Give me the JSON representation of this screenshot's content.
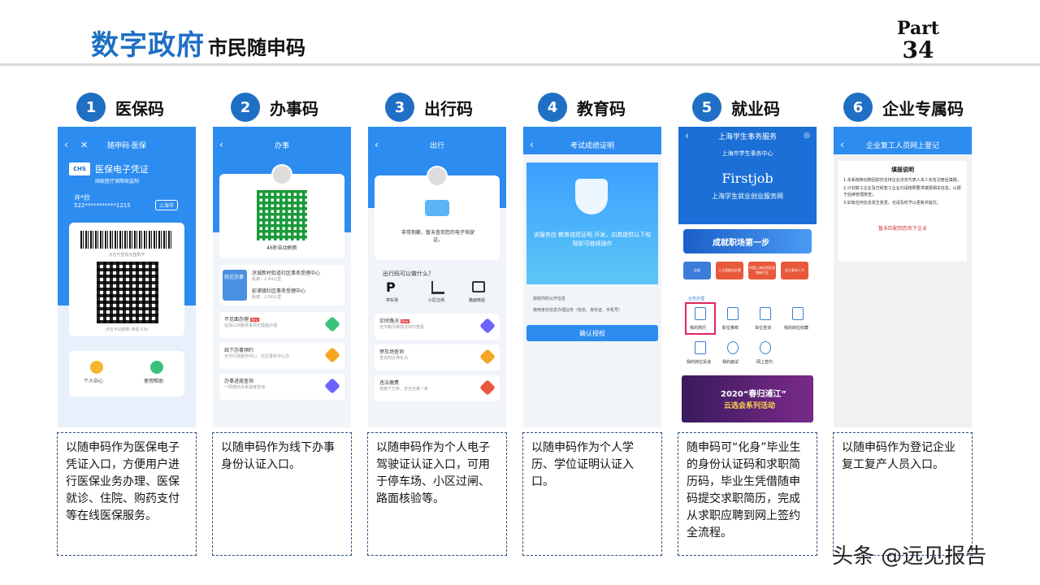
{
  "header": {
    "title_main": "数字政府",
    "title_sub": "市民随申码",
    "part_word": "Part",
    "part_num": "34"
  },
  "columns": [
    {
      "num": "1",
      "label": "医保码",
      "desc": "以随申码作为医保电子凭证入口，方便用户进行医保业务办理、医保就诊、住院、购药支付等在线医保服务。"
    },
    {
      "num": "2",
      "label": "办事码",
      "desc": "以随申码作为线下办事身份认证入口。"
    },
    {
      "num": "3",
      "label": "出行码",
      "desc": "以随申码作为个人电子驾驶证认证入口，可用于停车场、小区过闸、路面核验等。"
    },
    {
      "num": "4",
      "label": "教育码",
      "desc": "以随申码作为个人学历、学位证明认证入口。"
    },
    {
      "num": "5",
      "label": "就业码",
      "desc": "随申码可“化身”毕业生的身份认证码和求职简历码，毕业生凭借随申码提交求职简历，完成从求职应聘到网上签约全流程。"
    },
    {
      "num": "6",
      "label": "企业专属码",
      "desc": "以随申码作为登记企业复工复产人员入口。"
    }
  ],
  "phone1": {
    "nav_title": "随申码·医保",
    "card_title": "医保电子凭证",
    "card_sub": "国家医疗保障局监制",
    "logo": "CHS",
    "name": "许*欣",
    "id": "522***********1215",
    "city": "上海市",
    "barcode_hint": "点击可查看完整数字",
    "refresh_hint": "点击手动刷新 条码 53s",
    "btn_personal": "个人中心",
    "btn_help": "使用帮助"
  },
  "phone2": {
    "nav_title": "办事",
    "refresh": "46秒自动刷新",
    "banner": "就近办事",
    "center1": "凉城新村街道社区事务受理中心",
    "dist1": "距离：2.44公里",
    "center2": "彭浦镇社区事务受理中心",
    "dist2": "距离：2.56公里",
    "item1": "不见面办理",
    "item1_sub": "在线公共服务事项无需面办理",
    "item1_tag": "New",
    "item2": "线下办事预约",
    "item2_sub": "全市行政服务中心、社区事务中心办",
    "item3": "办事进度查询",
    "item3_sub": "一网通办办事进度查询"
  },
  "phone3": {
    "nav_title": "出行",
    "notice": "非常抱歉，暂未查到您的电子驾驶证。",
    "question": "出行码可以做什么？",
    "icon1": "停车场",
    "icon2": "小区过闸",
    "icon3": "路面核验",
    "item1": "实时路况",
    "item1_tag": "New",
    "item1_sub": "全市路况维情况实时查看",
    "item2": "停车场查询",
    "item2_sub": "查找附近停车点",
    "item3": "违法缴费",
    "item3_sub": "道路千万条，安全在第一条"
  },
  "phone4": {
    "nav_title": "考试成绩证明",
    "notice": "该服务由 教育成绩证明 开发，向其提供以下权限即可继续操作",
    "perm1": "获取你的公开信息",
    "perm2": "使用身份信息办理业务（姓名、身份证、手机号）",
    "button": "确认授权"
  },
  "phone5": {
    "nav_title": "上海学生事务服务",
    "sub_title": "上海市学生事务中心",
    "brand": "Firstjob",
    "brand_sub": "上海学生就业创业服务网",
    "banner": "成就职场第一步",
    "tile1": "全部",
    "tile2": "人工智能实训营",
    "tile3": "中国上海自贸区临港新片区",
    "tile4": "浙江青年人才",
    "section": "业务办理",
    "g1": "我的简历",
    "g2": "职位推荐",
    "g3": "单位查询",
    "g4": "我的岗位收藏",
    "g5": "我的岗位投递",
    "g6": "我的面试",
    "g7": "网上签约",
    "bottom_title": "2020“春归浦江”",
    "bottom_sub": "云选会系列活动"
  },
  "phone6": {
    "nav_title": "企业复工人员网上登记",
    "heading": "填报说明",
    "line1": "1.本系统移动随回前仅支持企业法定代表人本人实名注册后填报；",
    "line2": "2.计划复工企业及已经复工企业均请按照要求填报相关信息，以便于后续管理核查；",
    "line3": "3.如有任何信息发生变更，也请及时予以更新并提交。",
    "warning": "暂未匹配到您名下企业"
  },
  "watermark": "头条 @远见报告",
  "colors": {
    "accent": "#1f6fc5",
    "phone_blue": "#2d8cf0"
  }
}
